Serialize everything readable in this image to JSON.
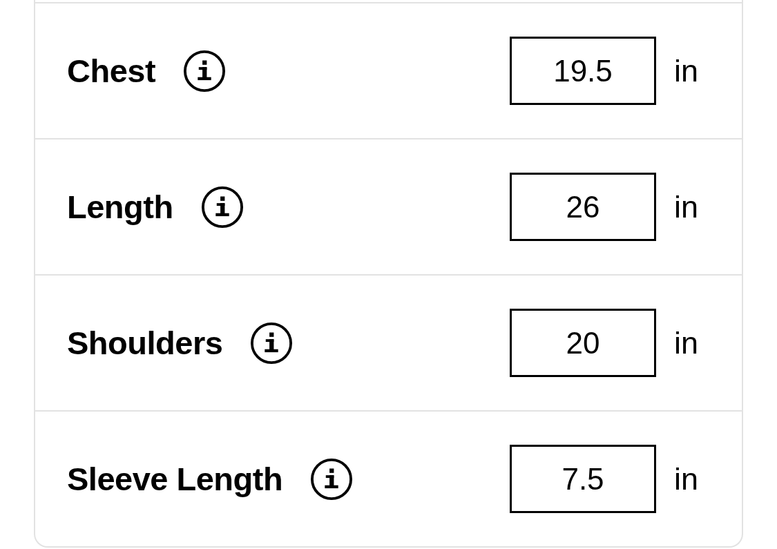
{
  "measurements": [
    {
      "label": "Chest",
      "value": "19.5",
      "unit": "in"
    },
    {
      "label": "Length",
      "value": "26",
      "unit": "in"
    },
    {
      "label": "Shoulders",
      "value": "20",
      "unit": "in"
    },
    {
      "label": "Sleeve Length",
      "value": "7.5",
      "unit": "in"
    }
  ]
}
